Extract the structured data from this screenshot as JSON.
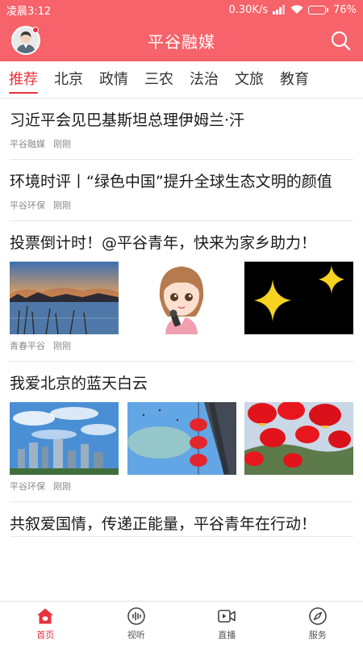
{
  "status": {
    "time": "凌晨3:12",
    "network_speed": "0.30K/s",
    "battery": "76%",
    "battery_level": 0.76
  },
  "header": {
    "title": "平谷融媒"
  },
  "tabs": [
    "推荐",
    "北京",
    "政情",
    "三农",
    "法治",
    "文旅",
    "教育"
  ],
  "active_tab": 0,
  "articles": [
    {
      "title": "习近平会见巴基斯坦总理伊姆兰·汗",
      "source": "平谷融媒",
      "time": "刚刚"
    },
    {
      "title": "环境时评丨“绿色中国”提升全球生态文明的颜值",
      "source": "平谷环保",
      "time": "刚刚"
    },
    {
      "title": "投票倒计时！@平谷青年，快来为家乡助力！",
      "source": "青春平谷",
      "time": "刚刚",
      "images": [
        "sunset-lake",
        "cartoon-girl-mic",
        "yellow-sparkles"
      ]
    },
    {
      "title": "我爱北京的蓝天白云",
      "source": "平谷环保",
      "time": "刚刚",
      "images": [
        "city-blue-sky",
        "red-lanterns-sky",
        "red-lanterns-street"
      ]
    },
    {
      "title": "共叙爱国情，传递正能量，平谷青年在行动！",
      "source": "",
      "time": ""
    }
  ],
  "bottom_nav": [
    {
      "label": "首页",
      "icon": "home-icon"
    },
    {
      "label": "视听",
      "icon": "audio-icon"
    },
    {
      "label": "直播",
      "icon": "video-icon"
    },
    {
      "label": "服务",
      "icon": "compass-icon"
    }
  ],
  "colors": {
    "brand": "#f6636a",
    "accent": "#e8333c"
  }
}
